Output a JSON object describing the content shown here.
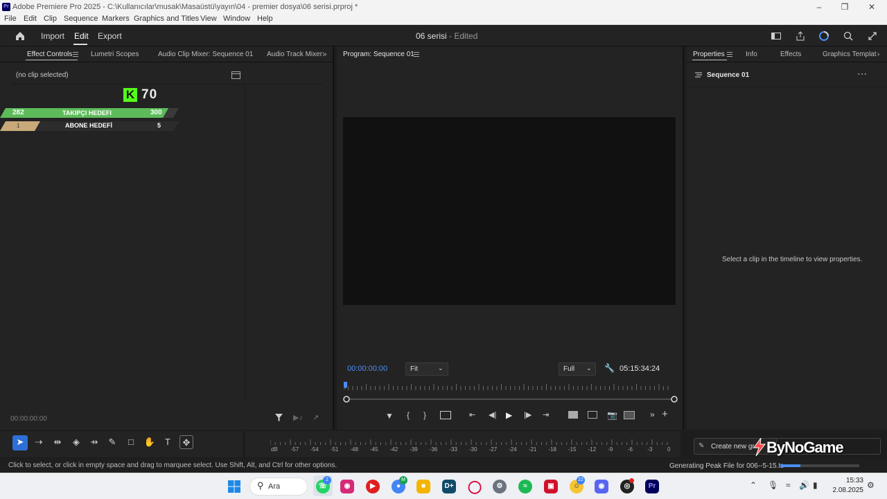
{
  "window": {
    "app_icon": "Pr",
    "title": "Adobe Premiere Pro 2025 - C:\\Kullanıcılar\\musak\\Masaüstü\\yayın\\04 - premier dosya\\06 serisi.prproj *"
  },
  "menu": [
    "File",
    "Edit",
    "Clip",
    "Sequence",
    "Markers",
    "Graphics and Titles",
    "View",
    "Window",
    "Help"
  ],
  "header": {
    "import": "Import",
    "edit": "Edit",
    "export": "Export",
    "project": "06 serisi",
    "edited": "- Edited"
  },
  "left_panel": {
    "tabs": [
      "Effect Controls",
      "Lumetri Scopes",
      "Audio Clip Mixer: Sequence 01",
      "Audio Track Mixer:"
    ],
    "no_clip": "(no clip selected)",
    "timecode": "00:00:00:00"
  },
  "overlay": {
    "k_logo": "K",
    "k_count": "70",
    "follower_current": "282",
    "follower_label": "TAKIPÇI HEDEFI",
    "follower_goal": "300",
    "follower_progress": 0.94,
    "sub_current": "1",
    "sub_label": "ABONE HEDEFİ",
    "sub_goal": "5",
    "sub_progress": 0.2
  },
  "program": {
    "tab": "Program: Sequence 01",
    "timecode": "00:00:00:00",
    "fit": "Fit",
    "full": "Full",
    "duration": "05:15:34:24"
  },
  "right_panel": {
    "tabs": [
      "Properties",
      "Info",
      "Effects",
      "Graphics Templat"
    ],
    "sequence": "Sequence 01",
    "empty_msg": "Select a clip in the timeline to view properties.",
    "create_new": "Create new gr",
    "watermark": "ByNoGame"
  },
  "meter_labels": [
    "dB",
    "-57",
    "-54",
    "-51",
    "-48",
    "-45",
    "-42",
    "-39",
    "-36",
    "-33",
    "-30",
    "-27",
    "-24",
    "-21",
    "-18",
    "-15",
    "-12",
    "-9",
    "-6",
    "-3",
    "0"
  ],
  "status": {
    "hint": "Click to select, or click in empty space and drag to marquee select. Use Shift, Alt, and Ctrl for other options.",
    "generating": "Generating Peak File for 006--5-15.ts",
    "progress": 0.25
  },
  "taskbar": {
    "search": "Ara",
    "time": "15:33",
    "date": "2.08.2025",
    "whatsapp_badge": "2",
    "chrome_badge": "M",
    "smile_badge": "22"
  },
  "colors": {
    "accent_blue": "#4b8df8",
    "green_bar": "#5dbb5a",
    "gold_bar": "#c8a97a",
    "kick_green": "#53fc18"
  }
}
